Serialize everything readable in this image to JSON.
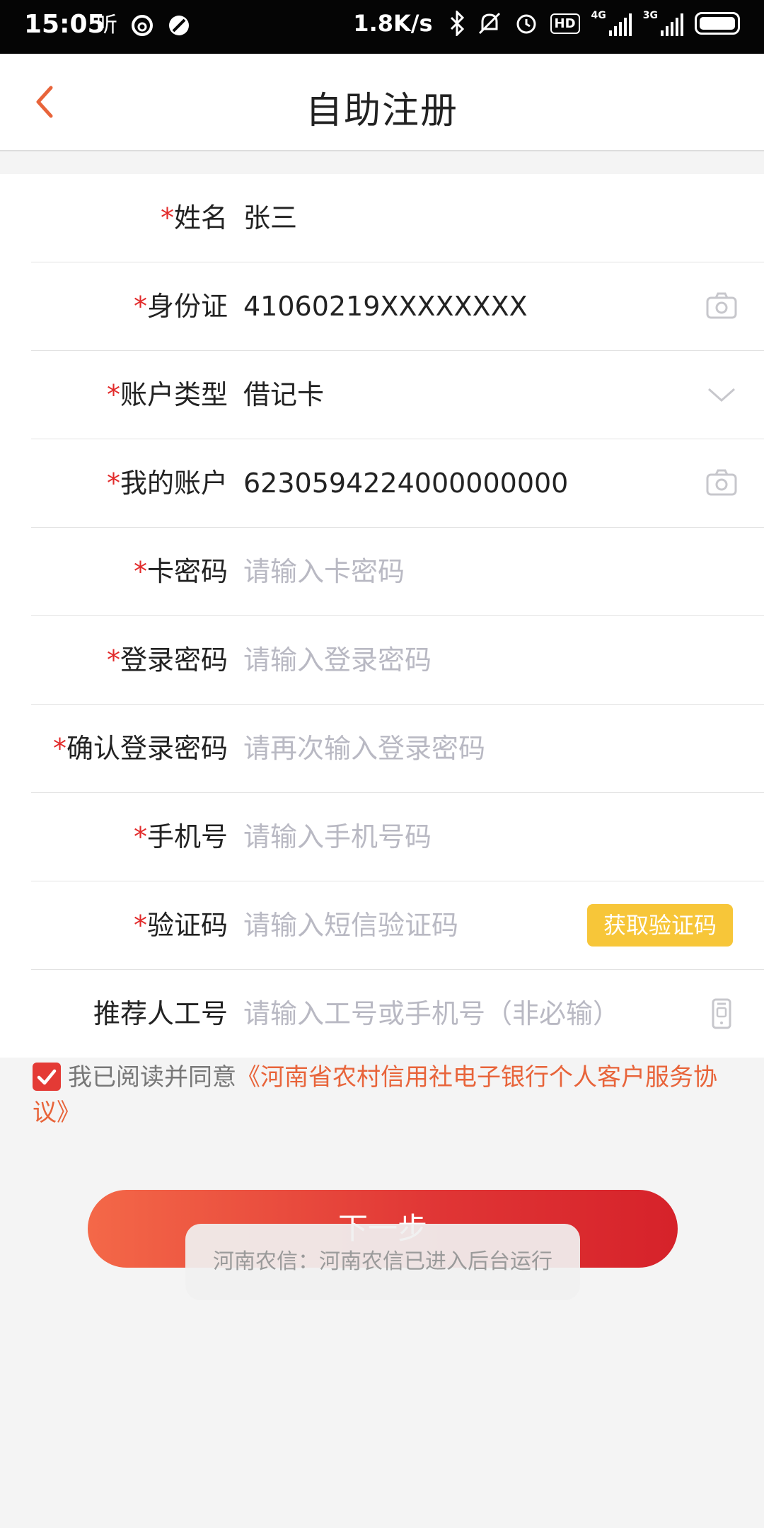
{
  "status_bar": {
    "time": "15:05",
    "left_icon_text": "听",
    "net_speed": "1.8K/s",
    "hd_label": "HD",
    "network1_label": "4G",
    "network2_label": "3G",
    "icons": [
      "netease-music-icon",
      "block-icon",
      "bluetooth-icon",
      "mute-icon",
      "alarm-icon",
      "battery-icon"
    ]
  },
  "header": {
    "title": "自助注册"
  },
  "form": {
    "fields": [
      {
        "label": "姓名",
        "required": "*",
        "value": "张三",
        "placeholder": ""
      },
      {
        "label": "身份证",
        "required": "*",
        "value": "41060219XXXXXXXX",
        "placeholder": ""
      },
      {
        "label": "账户类型",
        "required": "*",
        "value": "借记卡",
        "placeholder": ""
      },
      {
        "label": "我的账户",
        "required": "*",
        "value": "6230594224000000000",
        "placeholder": ""
      },
      {
        "label": "卡密码",
        "required": "*",
        "value": "",
        "placeholder": "请输入卡密码"
      },
      {
        "label": "登录密码",
        "required": "*",
        "value": "",
        "placeholder": "请输入登录密码"
      },
      {
        "label": "确认登录密码",
        "required": "*",
        "value": "",
        "placeholder": "请再次输入登录密码"
      },
      {
        "label": "手机号",
        "required": "*",
        "value": "",
        "placeholder": "请输入手机号码"
      },
      {
        "label": "验证码",
        "required": "*",
        "value": "",
        "placeholder": "请输入短信验证码"
      },
      {
        "label": "推荐人工号",
        "required": "",
        "value": "",
        "placeholder": "请输入工号或手机号（非必输）"
      }
    ],
    "sms_button": "获取验证码"
  },
  "agreement": {
    "checked": true,
    "text": "我已阅读并同意",
    "link": "《河南省农村信用社电子银行个人客户服务协议》"
  },
  "next_button": "下一步",
  "toast": "河南农信：河南农信已进入后台运行",
  "colors": {
    "required": "#e22b2b",
    "accent": "#e8643a",
    "button_start": "#f46848",
    "button_end": "#d6222a",
    "sms_button": "#f7c639"
  }
}
